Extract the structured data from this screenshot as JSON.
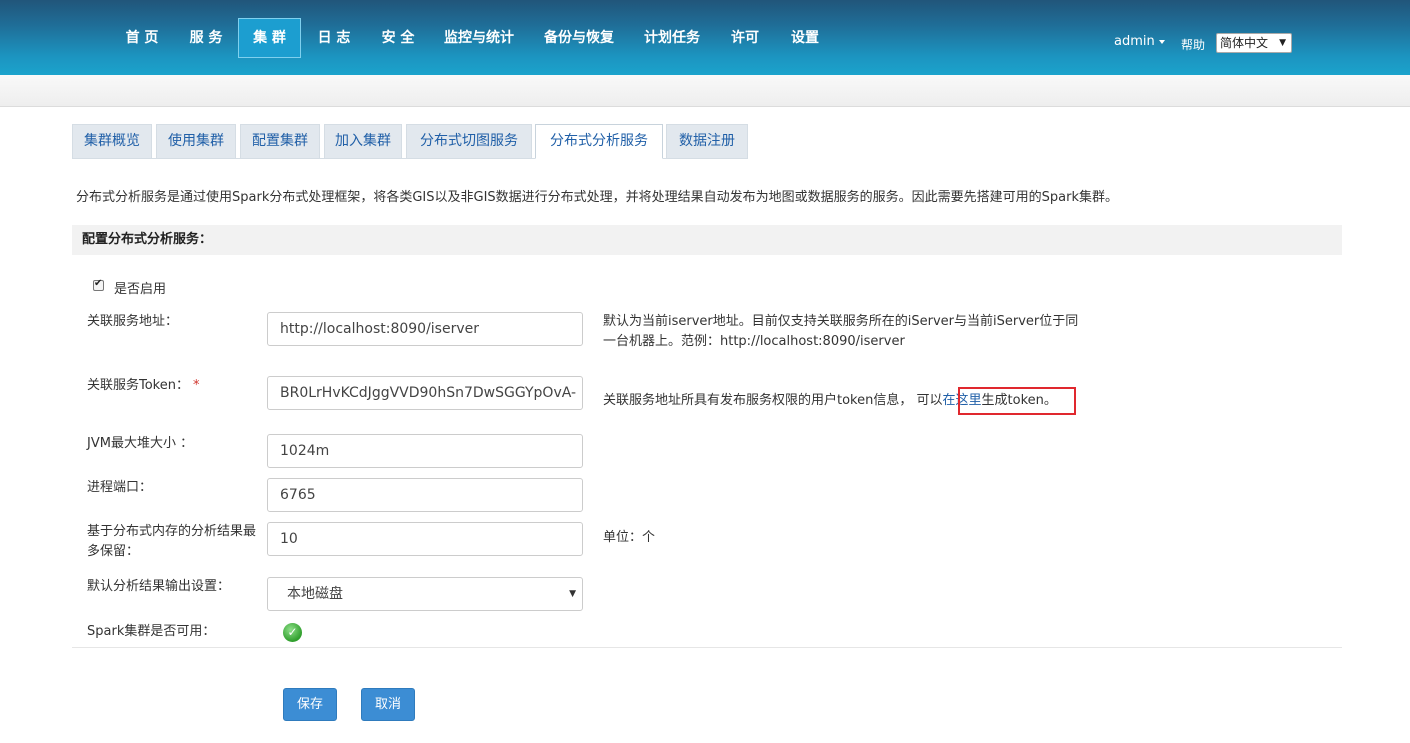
{
  "nav": {
    "items": [
      "首 页",
      "服 务",
      "集 群",
      "日 志",
      "安 全",
      "监控与统计",
      "备份与恢复",
      "计划任务",
      "许可",
      "设置"
    ],
    "active": "集 群",
    "user": "admin",
    "help": "帮助",
    "language": "简体中文"
  },
  "tabs": [
    "集群概览",
    "使用集群",
    "配置集群",
    "加入集群",
    "分布式切图服务",
    "分布式分析服务",
    "数据注册"
  ],
  "active_tab": "分布式分析服务",
  "description": "分布式分析服务是通过使用Spark分布式处理框架，将各类GIS以及非GIS数据进行分布式处理，并将处理结果自动发布为地图或数据服务的服务。因此需要先搭建可用的Spark集群。",
  "section_title": "配置分布式分析服务：",
  "form": {
    "enable_label": "是否启用",
    "enabled": true,
    "service_url": {
      "label": "关联服务地址：",
      "value": "http://localhost:8090/iserver",
      "hint_line1": "默认为当前iserver地址。目前仅支持关联服务所在的iServer与当前iServer位于同",
      "hint_line2": "一台机器上。范例：http://localhost:8090/iserver"
    },
    "token": {
      "label": "关联服务Token：",
      "required_mark": "*",
      "value": "BR0LrHvKCdJggVVD90hSn7DwSGGYpOvA-",
      "hint_prefix": "关联服务地址所具有发布服务权限的用户token信息，  可以",
      "hint_link": "在这里",
      "hint_suffix": "生成token。"
    },
    "jvm": {
      "label": "JVM最大堆大小 ：",
      "value": "1024m"
    },
    "port": {
      "label": "进程端口：",
      "value": "6765"
    },
    "max_results": {
      "label_line1": "基于分布式内存的分析结果最",
      "label_line2": "多保留：",
      "value": "10",
      "hint": "单位：个"
    },
    "output": {
      "label": "默认分析结果输出设置：",
      "value": "本地磁盘"
    },
    "spark": {
      "label": "Spark集群是否可用：",
      "available": true
    }
  },
  "buttons": {
    "save": "保存",
    "cancel": "取消"
  }
}
